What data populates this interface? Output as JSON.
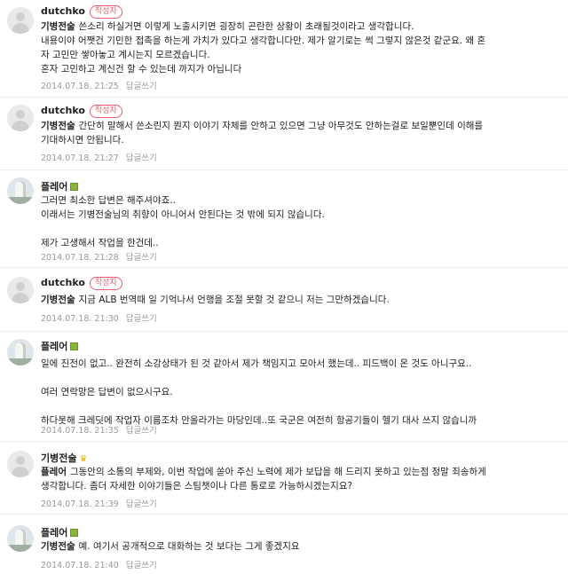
{
  "comments": [
    {
      "nickname": "dutchko",
      "author_badge": "작성자",
      "mention": "기병전술",
      "lines": [
        "쓴소리 하실거면 이렇게 노출시키면 굉장히 곤란한 상황이 초래될것이라고 생각합니다.",
        "내용이야 어쨋건 기민한 접촉을 하는게 가치가 있다고 생각합니다만. 제가 알기로는 썩 그렇지 않은것 같군요. 왜 혼",
        "자 고민만 쌓아놓고 계시는지 모르겠습니다.",
        "혼자 고민하고 계신건 할 수 있는데 까지가 아닙니다"
      ],
      "date": "2014.07.18. 21:25",
      "reply_label": "답글쓰기"
    },
    {
      "nickname": "dutchko",
      "author_badge": "작성자",
      "mention": "기병전술",
      "lines": [
        "간단히 말해서 쓴소린지 뭔지 이야기 자체를 안하고 있으면 그냥 아무것도 안하는걸로 보일뿐인데 이해를",
        "기대하시면 안됩니다."
      ],
      "date": "2014.07.18. 21:27",
      "reply_label": "답글쓰기"
    },
    {
      "nickname": "플레어",
      "mention": "",
      "lines": [
        "그러면 최소한 답변은 해주셔야죠..",
        "이래서는 기병전술님의 취향이 아니어서 안된다는 것 밖에 되지 않습니다.",
        "",
        "제가 고생해서 작업을 한건데.."
      ],
      "date": "2014.07.18. 21:28",
      "reply_label": "답글쓰기"
    },
    {
      "nickname": "dutchko",
      "author_badge": "작성자",
      "mention": "기병전술",
      "lines": [
        "지금 ALB 번역때 일 기억나서 언행을 조절 못할 것 같으니 저는 그만하겠습니다."
      ],
      "date": "2014.07.18. 21:30",
      "reply_label": "답글쓰기"
    },
    {
      "nickname": "플레어",
      "mention": "",
      "lines": [
        "일에 진전이 없고.. 완전히 소강상태가 된 것 같아서 제가 책임지고 모아서 했는데.. 피드백이 온 것도 아니구요..",
        "",
        "여러 연락망은 답변이 없으시구요.",
        "",
        "하다못해 크레딧에 작업자 이름조차 안올라가는 마당인데..또 국군은 여전히 항공기들이 헬기 대사 쓰지 않습니까"
      ],
      "date": "2014.07.18. 21:35",
      "reply_label": "답글쓰기"
    },
    {
      "nickname": "기병전술",
      "mention": "플레어",
      "lines": [
        "그동안의 소통의 부제와, 이번 작업에 쏟아 주신 노력에 제가 보답을 해 드리지 못하고 있는점 정말 죄송하게",
        "생각합니다. 좀더 자세한 이야기들은 스팀챗이나 다른 통로로 가능하시겠는지요?"
      ],
      "date": "2014.07.18. 21:39",
      "reply_label": "답글쓰기"
    },
    {
      "nickname": "플레어",
      "mention": "기병전술",
      "lines": [
        "예. 여기서 공개적으로 대화하는 것 보다는 그게 좋겠지요"
      ],
      "date": "2014.07.18. 21:40",
      "reply_label": "답글쓰기"
    }
  ],
  "icons": {
    "crown_color": "#e8b600",
    "level_color": "#8bb43a",
    "badge_color": "#f05a6b"
  }
}
